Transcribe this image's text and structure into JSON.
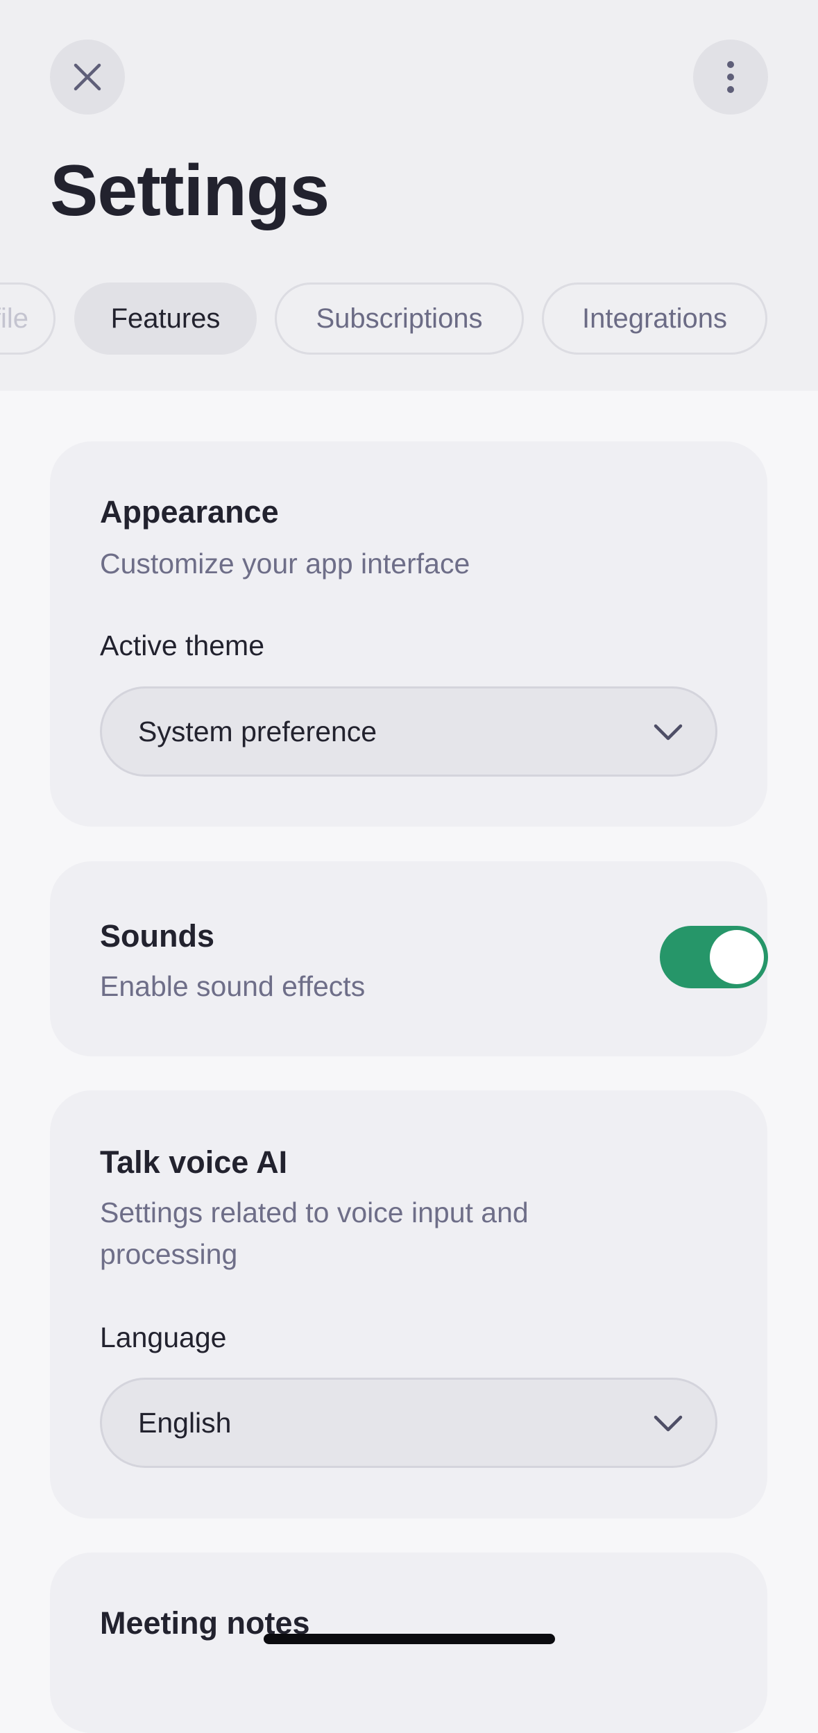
{
  "header": {
    "close_icon": "close-icon",
    "more_icon": "more-vertical-icon",
    "title": "Settings"
  },
  "tabs": [
    {
      "label": "Profile",
      "active": false
    },
    {
      "label": "Features",
      "active": true
    },
    {
      "label": "Subscriptions",
      "active": false
    },
    {
      "label": "Integrations",
      "active": false
    }
  ],
  "appearance": {
    "title": "Appearance",
    "subtitle": "Customize your app interface",
    "field_label": "Active theme",
    "select_value": "System preference"
  },
  "sounds": {
    "title": "Sounds",
    "subtitle": "Enable sound effects",
    "enabled": true
  },
  "voice": {
    "title": "Talk voice AI",
    "subtitle_line1": "Settings related to voice input and",
    "subtitle_line2": "processing",
    "field_label": "Language",
    "select_value": "English"
  },
  "meeting": {
    "title": "Meeting notes"
  },
  "colors": {
    "accent_toggle": "#269669",
    "text_primary": "#22222e",
    "text_secondary": "#6e6e88"
  }
}
